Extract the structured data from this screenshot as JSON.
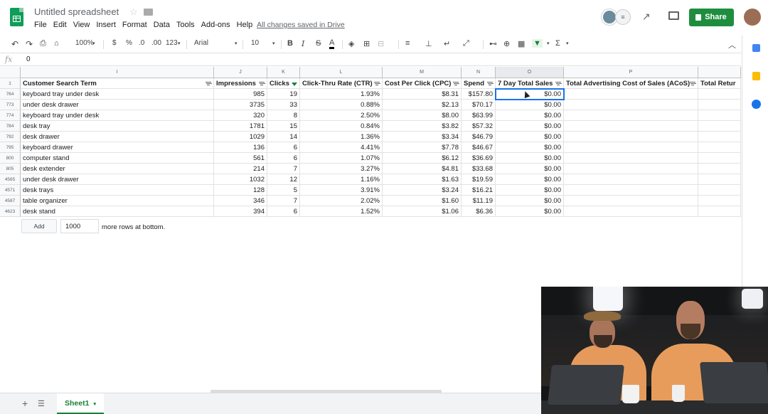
{
  "app": {
    "title": "Untitled spreadsheet",
    "saved_status": "All changes saved in Drive",
    "menu": [
      "File",
      "Edit",
      "View",
      "Insert",
      "Format",
      "Data",
      "Tools",
      "Add-ons",
      "Help"
    ],
    "share_label": "Share",
    "collab_count": "≡"
  },
  "toolbar": {
    "zoom": "100%",
    "currency": "$",
    "percent": "%",
    "dec_decrease": ".0",
    "dec_increase": ".00",
    "more_formats": "123",
    "font": "Arial",
    "font_size": "10",
    "bold": "B",
    "italic": "I",
    "strike": "S",
    "textcolor": "A",
    "sum": "Σ"
  },
  "formula_bar": {
    "fx": "fx",
    "value": "0"
  },
  "columns": [
    {
      "letter": "I",
      "header": "Customer Search Term",
      "filter": "plain"
    },
    {
      "letter": "J",
      "header": "Impressions",
      "filter": "plain"
    },
    {
      "letter": "K",
      "header": "Clicks",
      "filter": "active"
    },
    {
      "letter": "L",
      "header": "Click-Thru Rate (CTR)",
      "filter": "plain"
    },
    {
      "letter": "M",
      "header": "Cost Per Click (CPC)",
      "filter": "plain"
    },
    {
      "letter": "N",
      "header": "Spend",
      "filter": "plain"
    },
    {
      "letter": "O",
      "header": "7 Day Total Sales",
      "filter": "plain"
    },
    {
      "letter": "P",
      "header": "Total Advertising Cost of Sales (ACoS)",
      "filter": "plain"
    },
    {
      "letter": "",
      "header": "Total Retur",
      "filter": "none"
    }
  ],
  "header_row_number": "1",
  "rows": [
    {
      "row": "764",
      "term": "keyboard tray under desk",
      "impressions": "985",
      "clicks": "19",
      "ctr": "1.93%",
      "cpc": "$8.31",
      "spend": "$157.80",
      "sales": "$0.00"
    },
    {
      "row": "773",
      "term": "under desk drawer",
      "impressions": "3735",
      "clicks": "33",
      "ctr": "0.88%",
      "cpc": "$2.13",
      "spend": "$70.17",
      "sales": "$0.00"
    },
    {
      "row": "774",
      "term": "keyboard tray under desk",
      "impressions": "320",
      "clicks": "8",
      "ctr": "2.50%",
      "cpc": "$8.00",
      "spend": "$63.99",
      "sales": "$0.00"
    },
    {
      "row": "784",
      "term": "desk tray",
      "impressions": "1781",
      "clicks": "15",
      "ctr": "0.84%",
      "cpc": "$3.82",
      "spend": "$57.32",
      "sales": "$0.00"
    },
    {
      "row": "792",
      "term": "desk drawer",
      "impressions": "1029",
      "clicks": "14",
      "ctr": "1.36%",
      "cpc": "$3.34",
      "spend": "$46.79",
      "sales": "$0.00"
    },
    {
      "row": "795",
      "term": "keyboard drawer",
      "impressions": "136",
      "clicks": "6",
      "ctr": "4.41%",
      "cpc": "$7.78",
      "spend": "$46.67",
      "sales": "$0.00"
    },
    {
      "row": "800",
      "term": "computer stand",
      "impressions": "561",
      "clicks": "6",
      "ctr": "1.07%",
      "cpc": "$6.12",
      "spend": "$36.69",
      "sales": "$0.00"
    },
    {
      "row": "805",
      "term": "desk extender",
      "impressions": "214",
      "clicks": "7",
      "ctr": "3.27%",
      "cpc": "$4.81",
      "spend": "$33.68",
      "sales": "$0.00"
    },
    {
      "row": "4565",
      "term": "under desk drawer",
      "impressions": "1032",
      "clicks": "12",
      "ctr": "1.16%",
      "cpc": "$1.63",
      "spend": "$19.59",
      "sales": "$0.00"
    },
    {
      "row": "4571",
      "term": "desk trays",
      "impressions": "128",
      "clicks": "5",
      "ctr": "3.91%",
      "cpc": "$3.24",
      "spend": "$16.21",
      "sales": "$0.00"
    },
    {
      "row": "4587",
      "term": "table organizer",
      "impressions": "346",
      "clicks": "7",
      "ctr": "2.02%",
      "cpc": "$1.60",
      "spend": "$11.19",
      "sales": "$0.00"
    },
    {
      "row": "4623",
      "term": "desk stand",
      "impressions": "394",
      "clicks": "6",
      "ctr": "1.52%",
      "cpc": "$1.06",
      "spend": "$6.36",
      "sales": "$0.00"
    }
  ],
  "footer": {
    "add_label": "Add",
    "rows_value": "1000",
    "rows_text": "more rows at bottom."
  },
  "sheet_tab": "Sheet1",
  "colors": {
    "brand_green": "#0f9d58",
    "share_green": "#1e8e3e",
    "selection_blue": "#1a73e8"
  }
}
